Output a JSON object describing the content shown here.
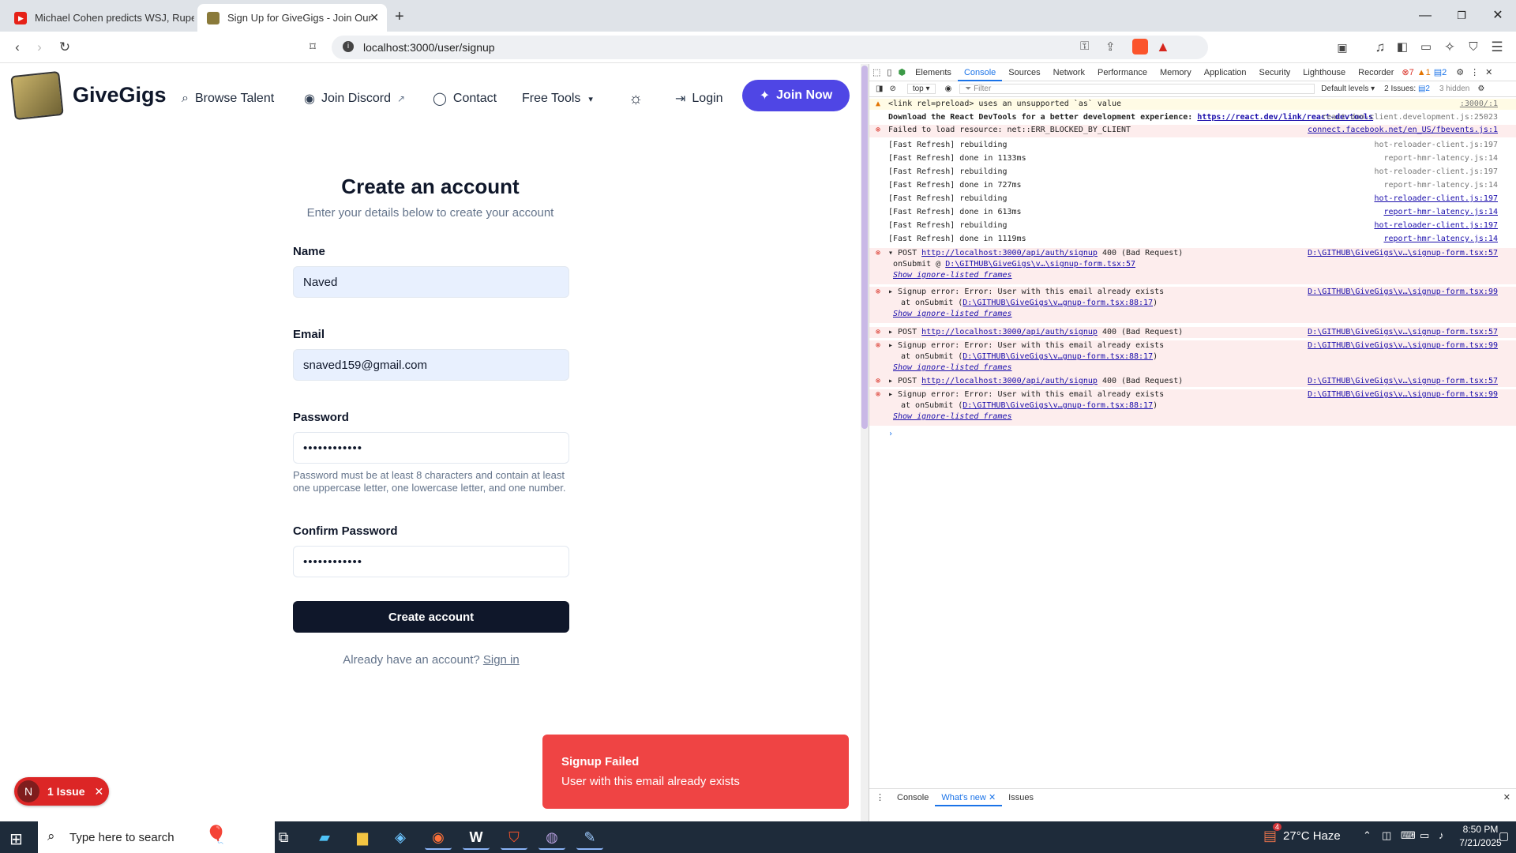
{
  "browser": {
    "tabs": [
      {
        "title": "Michael Cohen predicts WSJ, Rupert ",
        "favicon": "youtube-icon",
        "active": false
      },
      {
        "title": "Sign Up for GiveGigs - Join Our ",
        "favicon": "givegigs-icon",
        "active": true
      }
    ],
    "url": "localhost:3000/user/signup"
  },
  "site": {
    "logo_text": "GiveGigs",
    "nav": {
      "browse": "Browse Talent",
      "discord": "Join Discord",
      "contact": "Contact",
      "tools": "Free Tools",
      "login": "Login",
      "join": "Join Now"
    }
  },
  "form": {
    "title": "Create an account",
    "subtitle": "Enter your details below to create your account",
    "name_label": "Name",
    "name_value": "Naved",
    "email_label": "Email",
    "email_value": "snaved159@gmail.com",
    "password_label": "Password",
    "password_value": "••••••••••••",
    "password_hint": "Password must be at least 8 characters and contain at least one uppercase letter, one lowercase letter, and one number.",
    "confirm_label": "Confirm Password",
    "confirm_value": "••••••••••••",
    "submit_label": "Create account",
    "signin_prompt": "Already have an account?",
    "signin_link": "Sign in"
  },
  "issue_badge": {
    "avatar": "N",
    "label": "1 Issue"
  },
  "toast": {
    "title": "Signup Failed",
    "message": "User with this email already exists"
  },
  "devtools": {
    "tabs": [
      "Elements",
      "Console",
      "Sources",
      "Network",
      "Performance",
      "Memory",
      "Application",
      "Security",
      "Lighthouse",
      "Recorder"
    ],
    "active_tab": "Console",
    "counts": {
      "errors": "7",
      "warnings": "1",
      "info": "2"
    },
    "context": "top",
    "filter_placeholder": "Filter",
    "levels": "Default levels",
    "issues": "2 Issues:",
    "issues_count": "2",
    "hidden": "3 hidden",
    "logs": [
      {
        "type": "warn",
        "text": "<link rel=preload> uses an unsupported `as` value",
        "src": ":3000/:1"
      },
      {
        "type": "info",
        "text": "Download the React DevTools for a better development experience: ",
        "link": "https://react.dev/link/react-devtools",
        "src": "react-dom-client.development.js:25023"
      },
      {
        "type": "err",
        "text": "Failed to load resource: net::ERR_BLOCKED_BY_CLIENT",
        "src": "connect.facebook.net/en_US/fbevents.js:1"
      },
      {
        "type": "log",
        "text": "[Fast Refresh] rebuilding",
        "src": "hot-reloader-client.js:197"
      },
      {
        "type": "log",
        "text": "[Fast Refresh] done in 1133ms",
        "src": "report-hmr-latency.js:14"
      },
      {
        "type": "log",
        "text": "[Fast Refresh] rebuilding",
        "src": "hot-reloader-client.js:197"
      },
      {
        "type": "log",
        "text": "[Fast Refresh] done in 727ms",
        "src": "report-hmr-latency.js:14"
      },
      {
        "type": "log",
        "text": "[Fast Refresh] rebuilding",
        "src": "hot-reloader-client.js:197"
      },
      {
        "type": "log",
        "text": "[Fast Refresh] done in 613ms",
        "src": "report-hmr-latency.js:14"
      },
      {
        "type": "log",
        "text": "[Fast Refresh] rebuilding",
        "src": "hot-reloader-client.js:197"
      },
      {
        "type": "log",
        "text": "[Fast Refresh] done in 1119ms",
        "src": "report-hmr-latency.js:14"
      }
    ],
    "errors": [
      {
        "l1": "▾ POST ",
        "url": "http://localhost:3000/api/auth/signup",
        "l1b": " 400 (Bad Request)",
        "src": "D:\\GITHUB\\GiveGigs\\v…\\signup-form.tsx:57",
        "l2": "onSubmit @ ",
        "l2link": "D:\\GITHUB\\GiveGigs\\v…\\signup-form.tsx:57",
        "l3": "Show ignore-listed frames"
      },
      {
        "l1": "▸ Signup error: Error: User with this email already exists",
        "src": "D:\\GITHUB\\GiveGigs\\v…\\signup-form.tsx:99",
        "l2": "at onSubmit (",
        "l2link": "D:\\GITHUB\\GiveGigs\\v…gnup-form.tsx:88:17",
        "l2end": ")",
        "l3": "Show ignore-listed frames"
      },
      {
        "l1": "▸ POST ",
        "url": "http://localhost:3000/api/auth/signup",
        "l1b": " 400 (Bad Request)",
        "src": "D:\\GITHUB\\GiveGigs\\v…\\signup-form.tsx:57"
      },
      {
        "l1": "▸ Signup error: Error: User with this email already exists",
        "src": "D:\\GITHUB\\GiveGigs\\v…\\signup-form.tsx:99",
        "l2": "at onSubmit (",
        "l2link": "D:\\GITHUB\\GiveGigs\\v…gnup-form.tsx:88:17",
        "l2end": ")",
        "l3": "Show ignore-listed frames"
      },
      {
        "l1": "▸ POST ",
        "url": "http://localhost:3000/api/auth/signup",
        "l1b": " 400 (Bad Request)",
        "src": "D:\\GITHUB\\GiveGigs\\v…\\signup-form.tsx:57"
      },
      {
        "l1": "▸ Signup error: Error: User with this email already exists",
        "src": "D:\\GITHUB\\GiveGigs\\v…\\signup-form.tsx:99",
        "l2": "at onSubmit (",
        "l2link": "D:\\GITHUB\\GiveGigs\\v…gnup-form.tsx:88:17",
        "l2end": ")",
        "l3": "Show ignore-listed frames"
      }
    ],
    "prompt": "›",
    "bottom_tabs": [
      "Console",
      "What's new",
      "Issues"
    ],
    "bottom_active": "What's new"
  },
  "taskbar": {
    "search_placeholder": "Type here to search",
    "weather": "27°C  Haze",
    "weather_badge": "4",
    "time": "8:50 PM",
    "date": "7/21/2025"
  }
}
